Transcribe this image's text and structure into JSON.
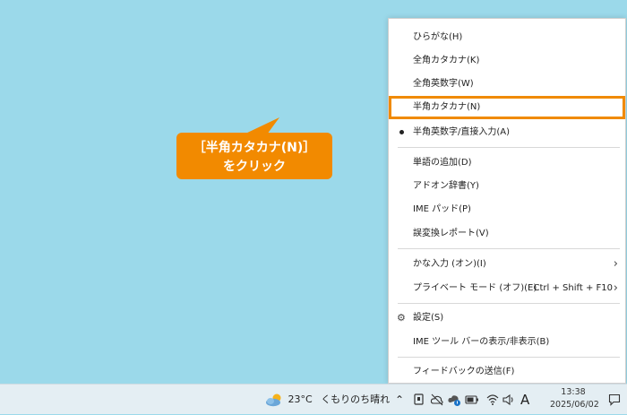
{
  "menu": {
    "items": [
      {
        "label": "ひらがな(H)"
      },
      {
        "label": "全角カタカナ(K)"
      },
      {
        "label": "全角英数字(W)"
      },
      {
        "label": "半角カタカナ(N)"
      },
      {
        "label": "半角英数字/直接入力(A)"
      },
      {
        "label": "単語の追加(D)"
      },
      {
        "label": "アドオン辞書(Y)"
      },
      {
        "label": "IME パッド(P)"
      },
      {
        "label": "誤変換レポート(V)"
      },
      {
        "label": "かな入力 (オン)(I)"
      },
      {
        "label": "プライベート モード (オフ)(E)",
        "shortcut": "Ctrl + Shift + F10"
      },
      {
        "label": "設定(S)"
      },
      {
        "label": "IME ツール バーの表示/非表示(B)"
      },
      {
        "label": "フィードバックの送信(F)"
      }
    ]
  },
  "callout": {
    "line1": "［半角カタカナ(N)］",
    "line2": "をクリック"
  },
  "taskbar": {
    "weather_temp": "23°C",
    "weather_text": "くもりのち晴れ",
    "ime_mode": "A",
    "time": "13:38",
    "date": "2025/06/02"
  },
  "colors": {
    "desktop": "#9bd9ea",
    "accent": "#f08a00"
  }
}
